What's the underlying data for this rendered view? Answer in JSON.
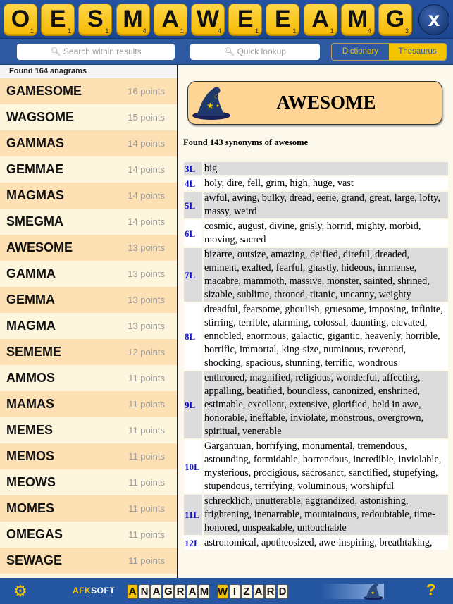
{
  "tiles": [
    {
      "letter": "O",
      "points": "1"
    },
    {
      "letter": "E",
      "points": "1"
    },
    {
      "letter": "S",
      "points": "1"
    },
    {
      "letter": "M",
      "points": "4"
    },
    {
      "letter": "A",
      "points": "1"
    },
    {
      "letter": "W",
      "points": "4"
    },
    {
      "letter": "E",
      "points": "1"
    },
    {
      "letter": "E",
      "points": "1"
    },
    {
      "letter": "A",
      "points": "1"
    },
    {
      "letter": "M",
      "points": "4"
    },
    {
      "letter": "G",
      "points": "3"
    }
  ],
  "clear_label": "x",
  "search": {
    "placeholder": "Search within results",
    "lookup_placeholder": "Quick lookup",
    "search_icon": "magnifier-icon"
  },
  "mode": {
    "options": [
      "Dictionary",
      "Thesaurus"
    ],
    "selected": "Thesaurus",
    "accent": "#f5c400"
  },
  "anagrams": {
    "found": "Found 164 anagrams",
    "items": [
      {
        "word": "GAMESOME",
        "points": "16 points"
      },
      {
        "word": "WAGSOME",
        "points": "15 points"
      },
      {
        "word": "GAMMAS",
        "points": "14 points"
      },
      {
        "word": "GEMMAE",
        "points": "14 points"
      },
      {
        "word": "MAGMAS",
        "points": "14 points"
      },
      {
        "word": "SMEGMA",
        "points": "14 points"
      },
      {
        "word": "AWESOME",
        "points": "13 points"
      },
      {
        "word": "GAMMA",
        "points": "13 points"
      },
      {
        "word": "GEMMA",
        "points": "13 points"
      },
      {
        "word": "MAGMA",
        "points": "13 points"
      },
      {
        "word": "SEMEME",
        "points": "12 points"
      },
      {
        "word": "AMMOS",
        "points": "11 points"
      },
      {
        "word": "MAMAS",
        "points": "11 points"
      },
      {
        "word": "MEMES",
        "points": "11 points"
      },
      {
        "word": "MEMOS",
        "points": "11 points"
      },
      {
        "word": "MEOWS",
        "points": "11 points"
      },
      {
        "word": "MOMES",
        "points": "11 points"
      },
      {
        "word": "OMEGAS",
        "points": "11 points"
      },
      {
        "word": "SEWAGE",
        "points": "11 points"
      },
      {
        "word": "",
        "points": ""
      }
    ]
  },
  "detail": {
    "word": "AWESOME",
    "found": "Found 143 synonyms of awesome",
    "rows": [
      {
        "len": "3L",
        "words": "big"
      },
      {
        "len": "4L",
        "words": "holy, dire, fell, grim, high, huge, vast"
      },
      {
        "len": "5L",
        "words": "awful, awing, bulky, dread, eerie, grand, great, large, lofty, massy, weird"
      },
      {
        "len": "6L",
        "words": "cosmic, august, divine, grisly, horrid, mighty, morbid, moving, sacred"
      },
      {
        "len": "7L",
        "words": "bizarre, outsize, amazing, deified, direful, dreaded, eminent, exalted, fearful, ghastly, hideous, immense, macabre, mammoth, massive, monster, sainted, shrined, sizable, sublime, throned, titanic, uncanny, weighty"
      },
      {
        "len": "8L",
        "words": "dreadful, fearsome, ghoulish, gruesome, imposing, infinite, stirring, terrible, alarming, colossal, daunting, elevated, ennobled, enormous, galactic, gigantic, heavenly, horrible, horrific, immortal, king-size, numinous, reverend, shocking, spacious, stunning, terrific, wondrous"
      },
      {
        "len": "9L",
        "words": "enthroned, magnified, religious, wonderful, affecting, appalling, beatified, boundless, canonized, enshrined, estimable, excellent, extensive, glorified, held in awe, honorable, ineffable, inviolate, monstrous, overgrown, spiritual, venerable"
      },
      {
        "len": "10L",
        "words": "Gargantuan, horrifying, monumental, tremendous, astounding, formidable, horrendous, incredible, inviolable, mysterious, prodigious, sacrosanct, sanctified, stupefying, stupendous, terrifying, voluminous, worshipful"
      },
      {
        "len": "11L",
        "words": "schrecklich, unutterable, aggrandized, astonishing, frightening, inenarrable, mountainous, redoubtable, time-honored, unspeakable, untouchable"
      },
      {
        "len": "12L",
        "words": "astronomical, apotheosized, awe-inspiring, breathtaking,"
      }
    ]
  },
  "footer": {
    "brand": "AFKSOFT",
    "logo_word1": "ANAGRAM",
    "logo_word2": "WIZARD",
    "help": "?",
    "settings_icon": "gear-icon"
  }
}
